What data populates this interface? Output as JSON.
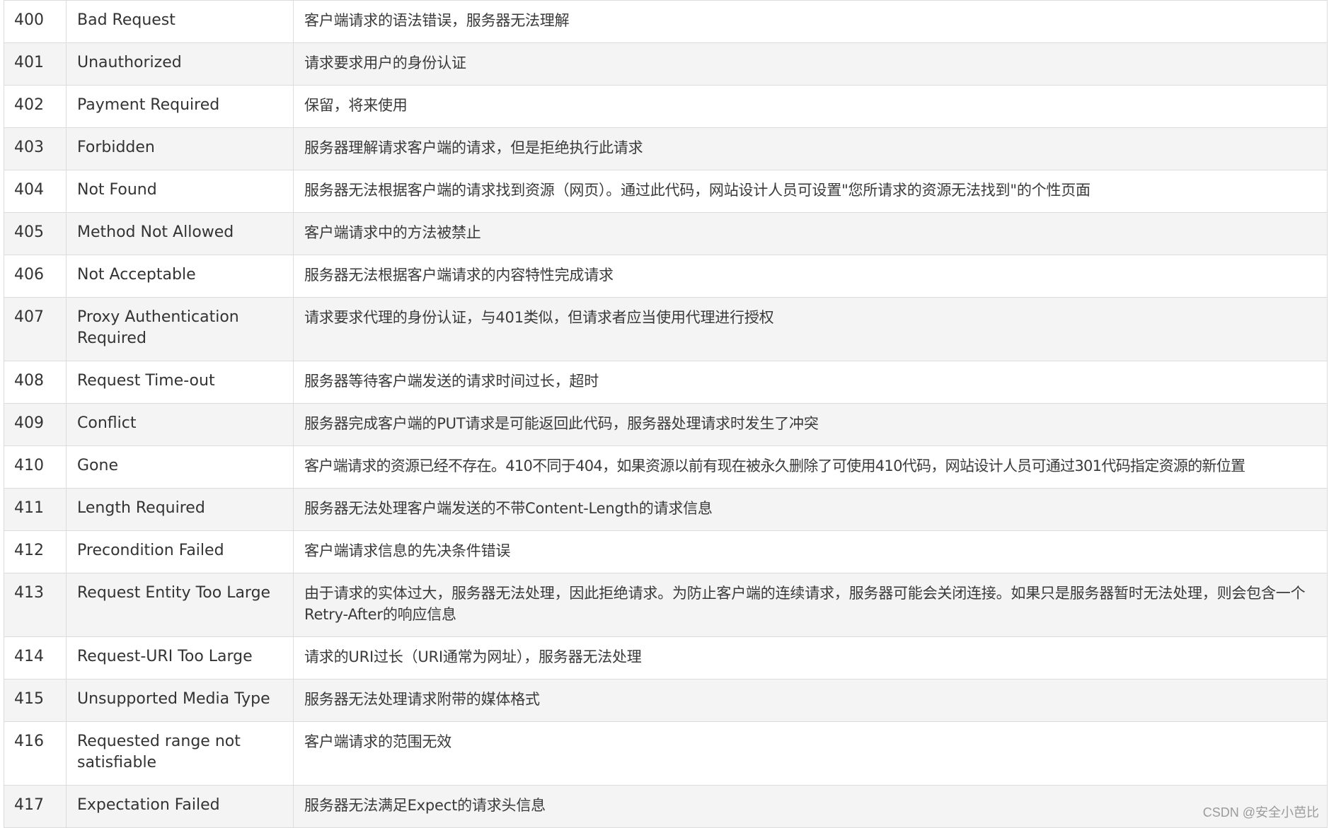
{
  "rows": [
    {
      "code": "400",
      "message": "Bad Request",
      "description": "客户端请求的语法错误，服务器无法理解"
    },
    {
      "code": "401",
      "message": "Unauthorized",
      "description": "请求要求用户的身份认证"
    },
    {
      "code": "402",
      "message": "Payment Required",
      "description": "保留，将来使用"
    },
    {
      "code": "403",
      "message": "Forbidden",
      "description": "服务器理解请求客户端的请求，但是拒绝执行此请求"
    },
    {
      "code": "404",
      "message": "Not Found",
      "description": "服务器无法根据客户端的请求找到资源（网页）。通过此代码，网站设计人员可设置\"您所请求的资源无法找到\"的个性页面"
    },
    {
      "code": "405",
      "message": "Method Not Allowed",
      "description": "客户端请求中的方法被禁止"
    },
    {
      "code": "406",
      "message": "Not Acceptable",
      "description": "服务器无法根据客户端请求的内容特性完成请求"
    },
    {
      "code": "407",
      "message": "Proxy Authentication Required",
      "description": "请求要求代理的身份认证，与401类似，但请求者应当使用代理进行授权"
    },
    {
      "code": "408",
      "message": "Request Time-out",
      "description": "服务器等待客户端发送的请求时间过长，超时"
    },
    {
      "code": "409",
      "message": "Conflict",
      "description": "服务器完成客户端的PUT请求是可能返回此代码，服务器处理请求时发生了冲突"
    },
    {
      "code": "410",
      "message": "Gone",
      "description": "客户端请求的资源已经不存在。410不同于404，如果资源以前有现在被永久删除了可使用410代码，网站设计人员可通过301代码指定资源的新位置"
    },
    {
      "code": "411",
      "message": "Length Required",
      "description": "服务器无法处理客户端发送的不带Content-Length的请求信息"
    },
    {
      "code": "412",
      "message": "Precondition Failed",
      "description": "客户端请求信息的先决条件错误"
    },
    {
      "code": "413",
      "message": "Request Entity Too Large",
      "description": "由于请求的实体过大，服务器无法处理，因此拒绝请求。为防止客户端的连续请求，服务器可能会关闭连接。如果只是服务器暂时无法处理，则会包含一个Retry-After的响应信息"
    },
    {
      "code": "414",
      "message": "Request-URI Too Large",
      "description": "请求的URI过长（URI通常为网址），服务器无法处理"
    },
    {
      "code": "415",
      "message": "Unsupported Media Type",
      "description": "服务器无法处理请求附带的媒体格式"
    },
    {
      "code": "416",
      "message": "Requested range not satisfiable",
      "description": "客户端请求的范围无效"
    },
    {
      "code": "417",
      "message": "Expectation Failed",
      "description": "服务器无法满足Expect的请求头信息"
    }
  ],
  "watermark": "CSDN @安全小芭比"
}
